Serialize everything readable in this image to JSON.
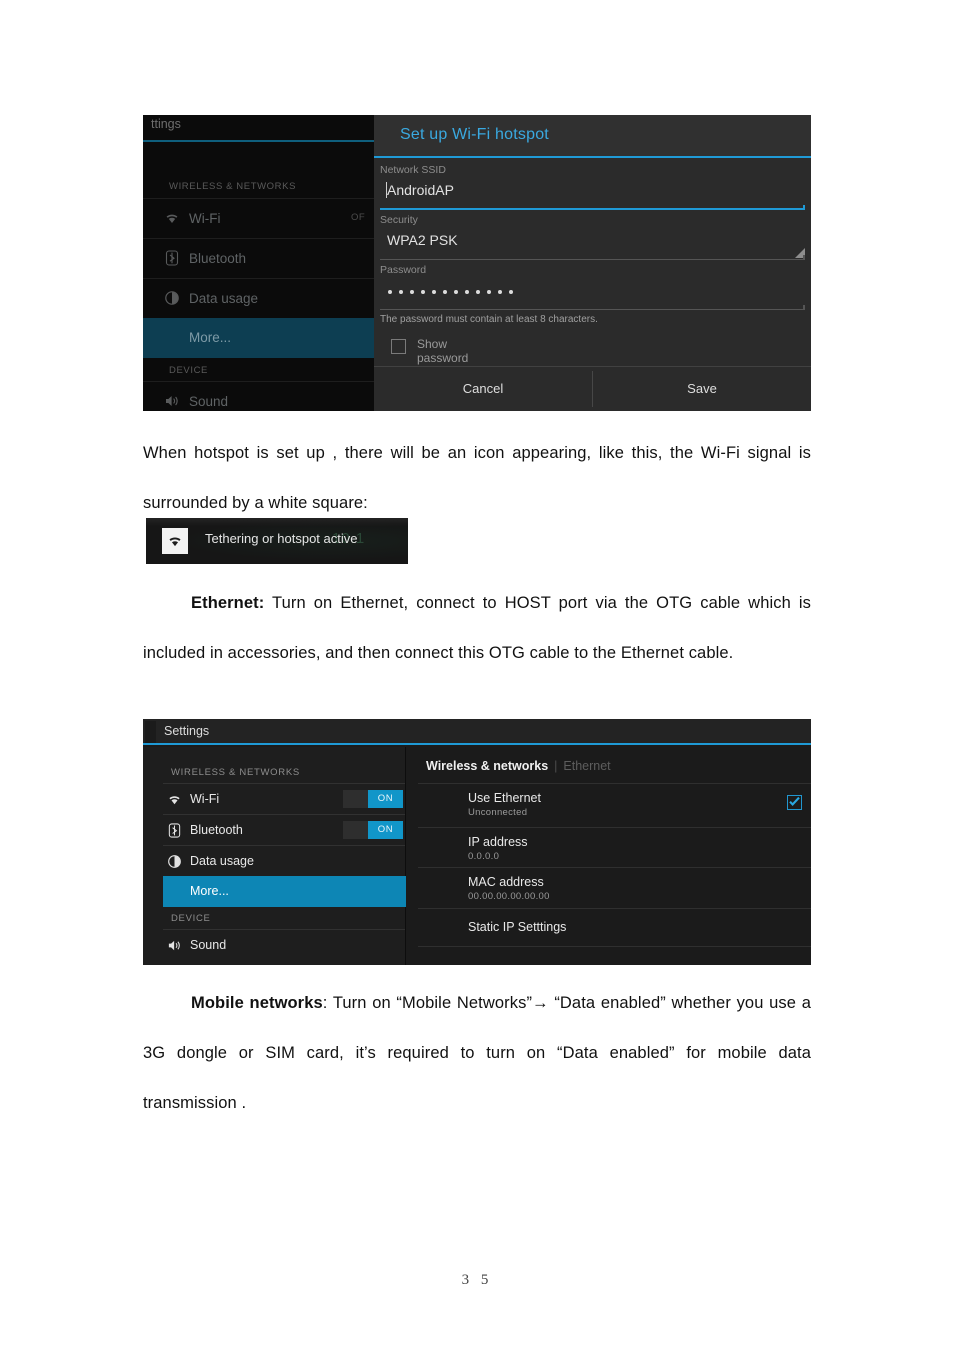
{
  "document": {
    "page_number": "3 5",
    "paragraphs": [
      {
        "id": "p-hotspot",
        "text": "When hotspot is set up , there will be an icon appearing, like this, the Wi-Fi signal is surrounded by a white square:"
      },
      {
        "id": "p-ethernet",
        "lead": "Ethernet:",
        "text": " Turn on Ethernet, connect to HOST port via the OTG cable which is included in accessories, and then connect this OTG cable to the Ethernet cable."
      },
      {
        "id": "p-mobile",
        "lead": "Mobile networks",
        "text": ": Turn on “Mobile Networks”→ “Data enabled” whether you use a 3G dongle or SIM card, it’s required to turn on  “Data enabled” for mobile data transmission ."
      }
    ]
  },
  "hotspot_screenshot": {
    "window_title": "ttings",
    "sidebar": {
      "section_wireless": "WIRELESS & NETWORKS",
      "section_device": "DEVICE",
      "items": [
        {
          "label": "Wi-Fi",
          "icon": "wifi-icon",
          "value": "OF"
        },
        {
          "label": "Bluetooth",
          "icon": "bluetooth-icon",
          "value": ""
        },
        {
          "label": "Data usage",
          "icon": "data-usage-icon",
          "value": ""
        },
        {
          "label": "More...",
          "icon": "",
          "value": "",
          "selected": true
        },
        {
          "label": "Sound",
          "icon": "sound-icon",
          "value": ""
        }
      ]
    },
    "dialog": {
      "title": "Set up Wi-Fi hotspot",
      "ssid_label": "Network SSID",
      "ssid_value": "AndroidAP",
      "security_label": "Security",
      "security_value": "WPA2 PSK",
      "password_label": "Password",
      "password_dots": 12,
      "password_hint": "The password must contain at least 8 characters.",
      "show_password_label": "Show password",
      "show_password_checked": false,
      "cancel_label": "Cancel",
      "save_label": "Save",
      "accent_color": "#1f9ad6",
      "title_color": "#3aa9e0"
    }
  },
  "tether_badge": {
    "label": "Tethering or hotspot active",
    "icon": "wifi-hotspot-icon",
    "ghost_text": "10.1"
  },
  "ethernet_screenshot": {
    "app_bar_title": "Settings",
    "accent_color": "#1f9ad6",
    "sidebar": {
      "section_wireless": "WIRELESS & NETWORKS",
      "section_device": "DEVICE",
      "items": [
        {
          "label": "Wi-Fi",
          "icon": "wifi-icon",
          "toggle": "ON"
        },
        {
          "label": "Bluetooth",
          "icon": "bluetooth-icon",
          "toggle": "ON"
        },
        {
          "label": "Data usage",
          "icon": "data-usage-icon",
          "toggle": ""
        },
        {
          "label": "More...",
          "icon": "",
          "toggle": "",
          "selected": true
        },
        {
          "label": "Sound",
          "icon": "sound-icon",
          "toggle": ""
        }
      ]
    },
    "content": {
      "breadcrumb_primary": "Wireless & networks",
      "breadcrumb_secondary": "Ethernet",
      "rows": [
        {
          "title": "Use Ethernet",
          "subtitle": "Unconnected",
          "checked": true
        },
        {
          "title": "IP address",
          "subtitle": "0.0.0.0",
          "checked": false
        },
        {
          "title": "MAC address",
          "subtitle": "00.00.00.00.00.00",
          "checked": false
        },
        {
          "title": "Static IP Setttings",
          "subtitle": "",
          "checked": false
        }
      ]
    }
  }
}
